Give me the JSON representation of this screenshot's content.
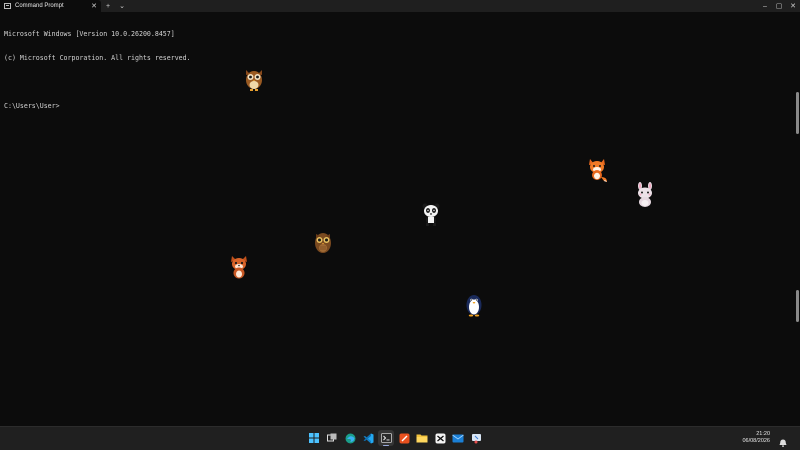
{
  "window": {
    "tab_title": "Command Prompt",
    "tab_close": "✕",
    "new_tab": "+",
    "dropdown": "⌄",
    "minimize": "–",
    "maximize": "▢",
    "close": "✕"
  },
  "console": {
    "line1": "Microsoft Windows [Version 10.0.26200.8457]",
    "line2": "(c) Microsoft Corporation. All rights reserved.",
    "line3": "",
    "prompt": "C:\\Users\\User>"
  },
  "pets": [
    {
      "name": "owl-pet-icon"
    },
    {
      "name": "fox-pet-icon"
    },
    {
      "name": "rabbit-pet-icon"
    },
    {
      "name": "panda-pet-icon"
    },
    {
      "name": "owl-pet-icon"
    },
    {
      "name": "fox-pet-icon"
    },
    {
      "name": "penguin-pet-icon"
    }
  ],
  "taskbar": {
    "apps": [
      "windows-start-icon",
      "task-view-icon",
      "edge-icon",
      "vscode-icon",
      "terminal-icon",
      "paint-icon",
      "file-explorer-icon",
      "capcut-icon",
      "mail-icon",
      "snipping-tool-icon"
    ],
    "time": "21:20",
    "date": "06/08/2026"
  },
  "colors": {
    "console_bg": "#0c0c0c",
    "titlebar_bg": "#1f1f1f",
    "taskbar_bg": "#202020",
    "text": "#d4d4d4"
  }
}
